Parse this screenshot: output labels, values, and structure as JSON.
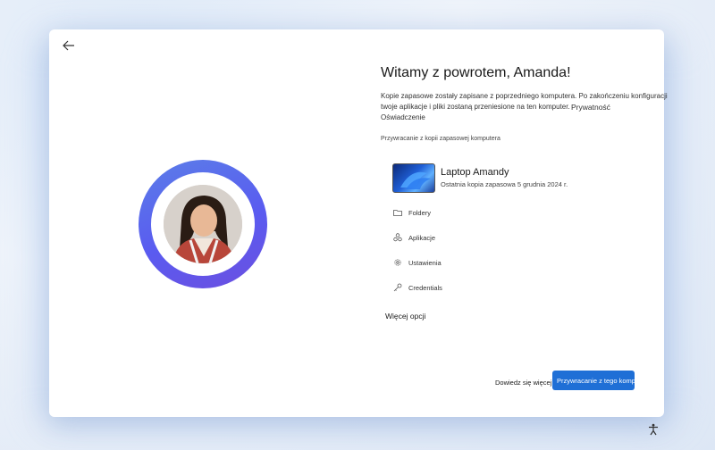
{
  "header": {
    "back_label": ""
  },
  "welcome": {
    "title": "Witamy z powrotem, Amanda!",
    "desc_line1": "Kopie zapasowe zostały zapisane z poprzedniego komputera.  Po zakończeniu konfiguracji",
    "desc_line2": "twoje aplikacje i pliki zostaną przeniesione na ten komputer.",
    "privacy": "Prywatność",
    "declaration": "Oświadczenie"
  },
  "backup": {
    "section_label": "Przywracanie z kopii zapasowej komputera",
    "device_name": "Laptop Amandy",
    "device_sub": "Ostatnia kopia zapasowa  5 grudnia 2024 r.",
    "items": [
      {
        "label": "Foldery",
        "icon": "folder-icon"
      },
      {
        "label": "Aplikacje",
        "icon": "apps-icon"
      },
      {
        "label": "Ustawienia",
        "icon": "gear-icon"
      },
      {
        "label": "Credentials",
        "icon": "key-icon"
      }
    ],
    "more_options": "Więcej opcji"
  },
  "footer": {
    "learn_more": "Dowiedz się więcej",
    "primary_button": "Przywracanie z tego komputera"
  },
  "colors": {
    "accent": "#1f6fd6",
    "ring_start": "#5b7ee8",
    "ring_end": "#6b4fe0"
  }
}
